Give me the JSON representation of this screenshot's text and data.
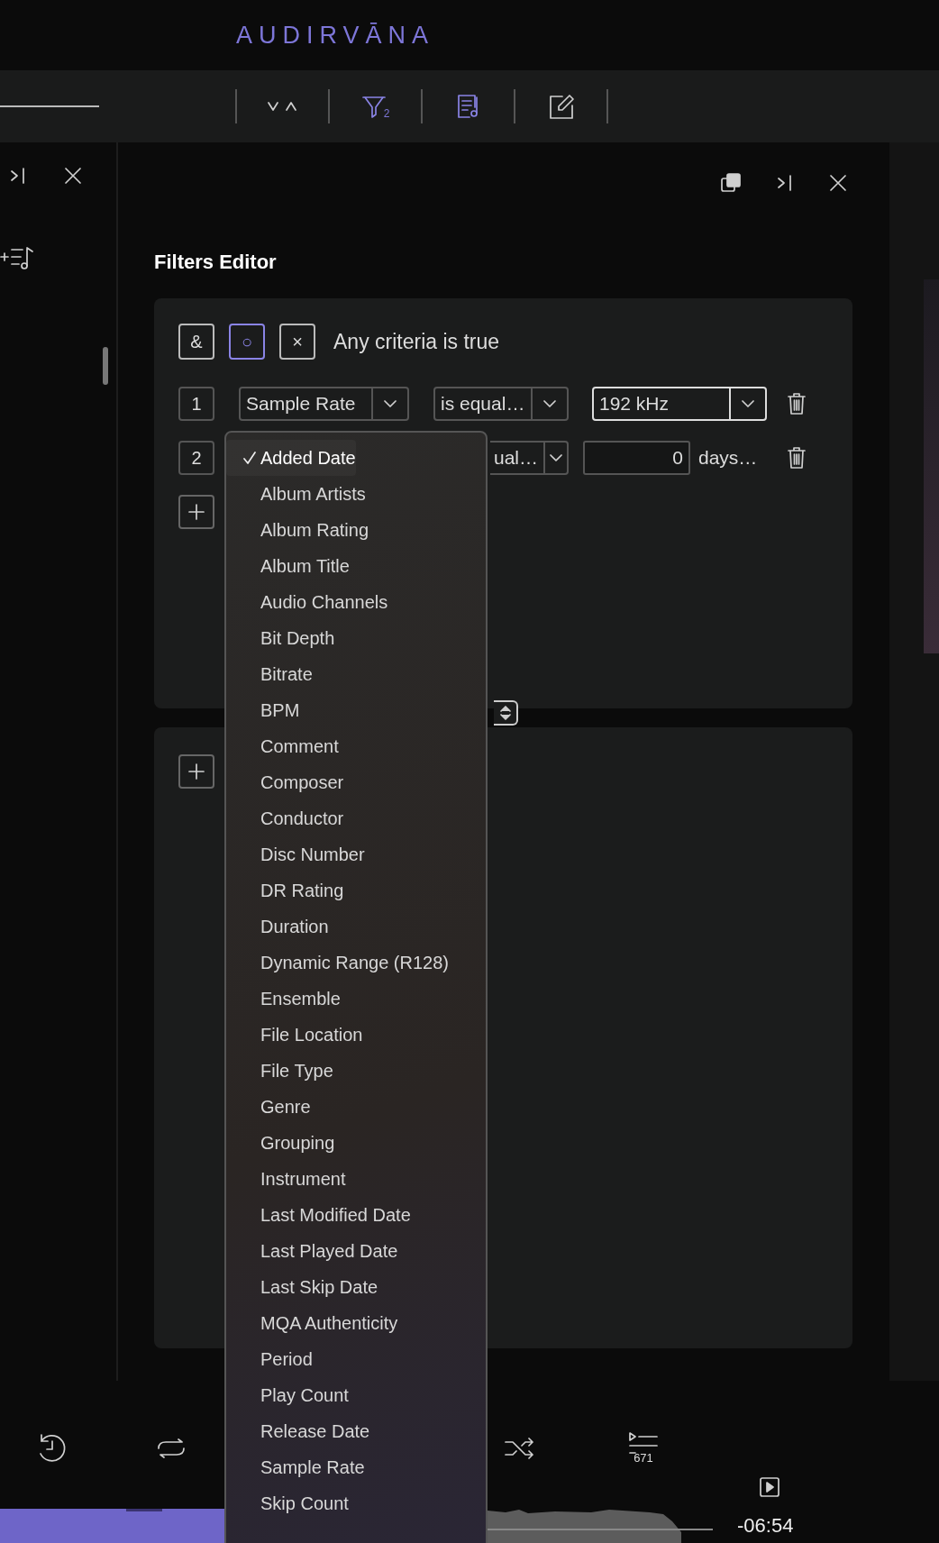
{
  "app": {
    "logo": "AUDIRVĀNA"
  },
  "toolbar": {
    "filter_count": "2"
  },
  "panel": {
    "title": "Filters Editor"
  },
  "criteria": {
    "modes": [
      {
        "label": "&",
        "selected": false
      },
      {
        "label": "○",
        "selected": true
      },
      {
        "label": "×",
        "selected": false
      }
    ],
    "description": "Any criteria is true"
  },
  "rules": [
    {
      "index": "1",
      "kind": "select",
      "field": "Sample Rate",
      "operator": "is equal…",
      "value": "192 kHz",
      "highlighted": true
    },
    {
      "index": "2",
      "kind": "number",
      "operator": "ual…",
      "value": "0",
      "unit": "days…",
      "highlighted": false
    }
  ],
  "dropdown": {
    "items": [
      {
        "label": "Added Date",
        "selected": true
      },
      {
        "label": "Album Artists",
        "selected": false
      },
      {
        "label": "Album Rating",
        "selected": false
      },
      {
        "label": "Album Title",
        "selected": false
      },
      {
        "label": "Audio Channels",
        "selected": false
      },
      {
        "label": "Bit Depth",
        "selected": false
      },
      {
        "label": "Bitrate",
        "selected": false
      },
      {
        "label": "BPM",
        "selected": false
      },
      {
        "label": "Comment",
        "selected": false
      },
      {
        "label": "Composer",
        "selected": false
      },
      {
        "label": "Conductor",
        "selected": false
      },
      {
        "label": "Disc Number",
        "selected": false
      },
      {
        "label": "DR Rating",
        "selected": false
      },
      {
        "label": "Duration",
        "selected": false
      },
      {
        "label": "Dynamic Range (R128)",
        "selected": false
      },
      {
        "label": "Ensemble",
        "selected": false
      },
      {
        "label": "File Location",
        "selected": false
      },
      {
        "label": "File Type",
        "selected": false
      },
      {
        "label": "Genre",
        "selected": false
      },
      {
        "label": "Grouping",
        "selected": false
      },
      {
        "label": "Instrument",
        "selected": false
      },
      {
        "label": "Last Modified Date",
        "selected": false
      },
      {
        "label": "Last Played Date",
        "selected": false
      },
      {
        "label": "Last Skip Date",
        "selected": false
      },
      {
        "label": "MQA Authenticity",
        "selected": false
      },
      {
        "label": "Period",
        "selected": false
      },
      {
        "label": "Play Count",
        "selected": false
      },
      {
        "label": "Release Date",
        "selected": false
      },
      {
        "label": "Sample Rate",
        "selected": false
      },
      {
        "label": "Skip Count",
        "selected": false
      }
    ]
  },
  "player": {
    "queue_count": "671",
    "remaining": "-06:54"
  }
}
